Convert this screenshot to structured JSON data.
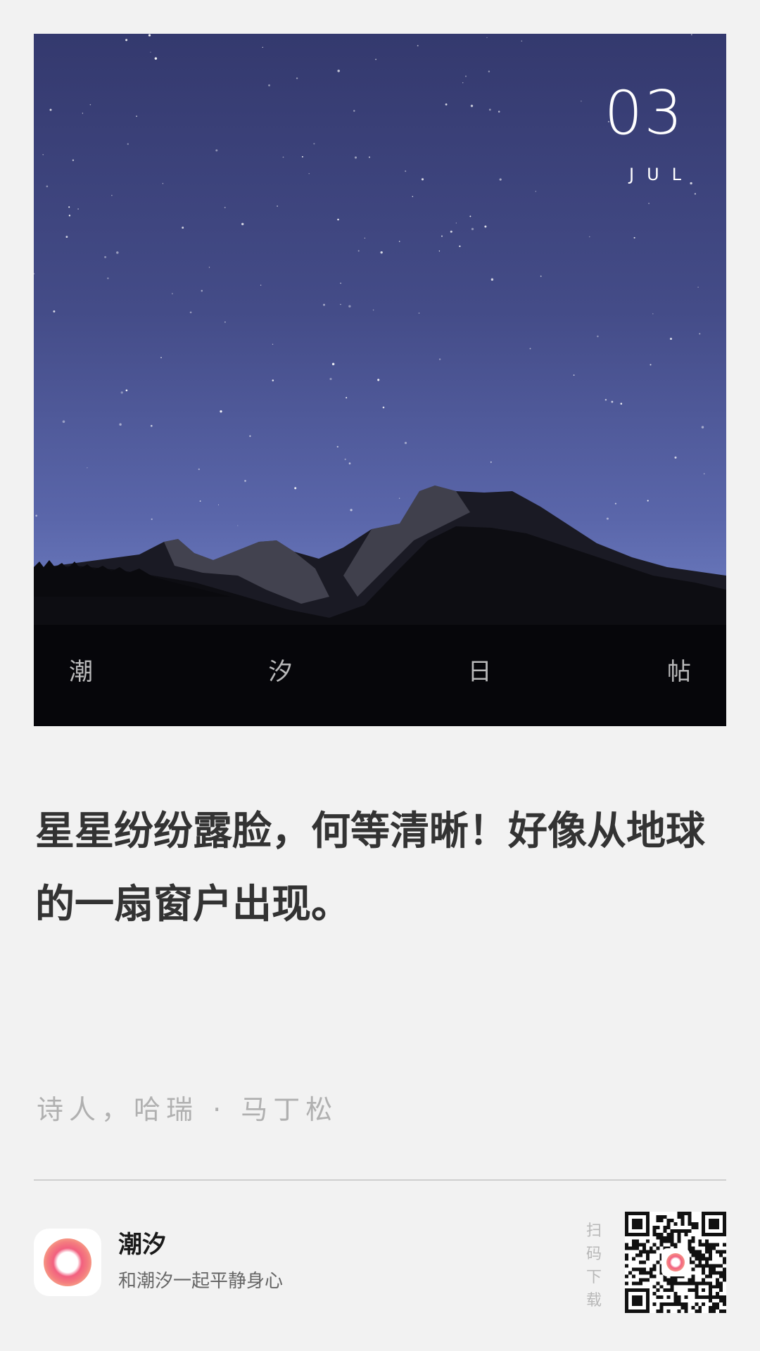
{
  "post": {
    "day": "03",
    "month": "JUL",
    "brand_chars": [
      "潮",
      "汐",
      "日",
      "帖"
    ],
    "quote": "星星纷纷露脸，何等清晰！好像从地球的一扇窗户出现。",
    "author": "诗人，哈瑞 · 马丁松"
  },
  "footer": {
    "app_name": "潮汐",
    "slogan": "和潮汐一起平静身心",
    "scan_chars": [
      "扫",
      "码",
      "下",
      "载"
    ]
  },
  "colors": {
    "background": "#f2f2f2",
    "sky_top": "#34396e",
    "sky_bottom": "#6a79bd",
    "text_primary": "#333333",
    "text_muted": "#b0b0b0",
    "accent_pink": "#f2607f"
  },
  "icons": {
    "app_logo": "tide-ring-icon",
    "qr": "qr-code-icon"
  }
}
